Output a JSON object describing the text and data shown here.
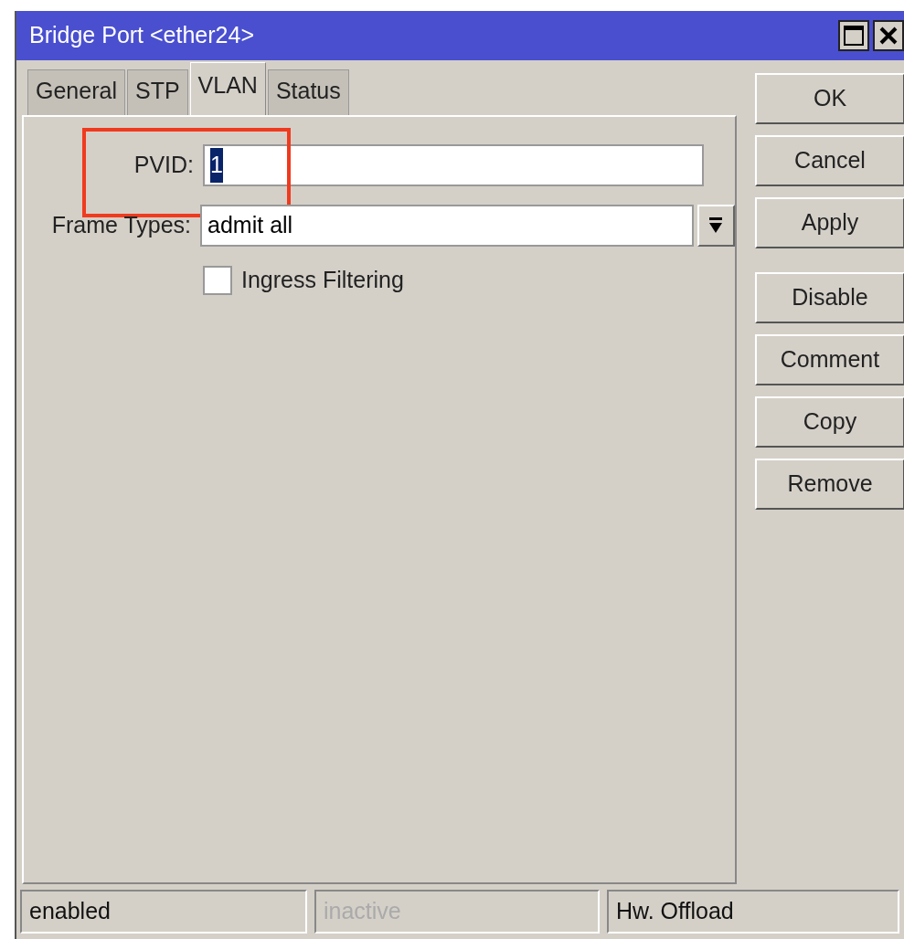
{
  "window": {
    "title": "Bridge Port <ether24>",
    "controls": [
      {
        "kind": "maximize"
      },
      {
        "kind": "close"
      }
    ]
  },
  "tabs": [
    {
      "label": "General",
      "selected": false
    },
    {
      "label": "STP",
      "selected": false
    },
    {
      "label": "VLAN",
      "selected": true
    },
    {
      "label": "Status",
      "selected": false
    }
  ],
  "fields": [
    {
      "kind": "text",
      "label": "PVID:",
      "value": "1",
      "value_selected": true,
      "highlighted": true
    },
    {
      "kind": "dropdown",
      "label": "Frame Types:",
      "value": "admit all",
      "highlighted": false
    },
    {
      "kind": "checkbox",
      "label": "Ingress Filtering",
      "checked": false,
      "highlighted": false
    }
  ],
  "button_groups": [
    [
      {
        "label": "OK"
      },
      {
        "label": "Cancel"
      },
      {
        "label": "Apply"
      }
    ],
    [
      {
        "label": "Disable"
      },
      {
        "label": "Comment"
      },
      {
        "label": "Copy"
      },
      {
        "label": "Remove"
      }
    ]
  ],
  "status_bar": [
    {
      "text": "enabled",
      "disabled": false
    },
    {
      "text": "inactive",
      "disabled": true
    },
    {
      "text": "Hw. Offload",
      "disabled": false
    }
  ]
}
